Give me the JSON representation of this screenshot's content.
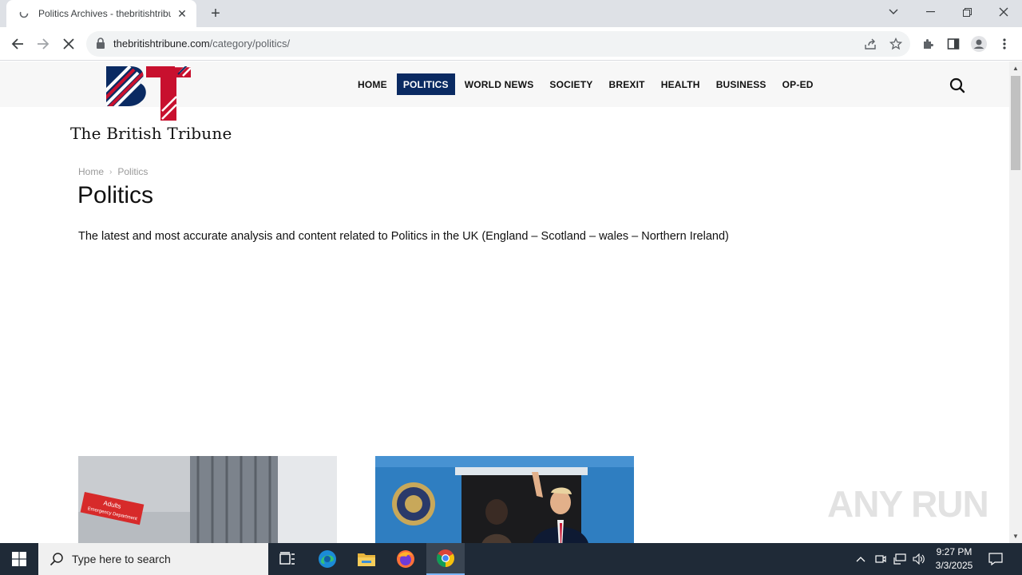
{
  "browser": {
    "tab_title": "Politics Archives - thebritishtribune",
    "url_host": "thebritishtribune.com",
    "url_path": "/category/politics/"
  },
  "site": {
    "logo_text": "The British Tribune",
    "logo_letters": "BT",
    "nav": [
      "HOME",
      "POLITICS",
      "WORLD NEWS",
      "SOCIETY",
      "BREXIT",
      "HEALTH",
      "BUSINESS",
      "OP-ED"
    ],
    "active_nav": "POLITICS",
    "colors": {
      "navy": "#0a2a62",
      "red": "#c8102e"
    }
  },
  "page": {
    "breadcrumb": [
      "Home",
      "Politics"
    ],
    "title": "Politics",
    "description": "The latest and most accurate analysis and content related to Politics in the UK (England – Scotland – wales – Northern Ireland)"
  },
  "watermark": "ANY RUN",
  "taskbar": {
    "search_placeholder": "Type here to search",
    "time": "9:27 PM",
    "date": "3/3/2025"
  }
}
